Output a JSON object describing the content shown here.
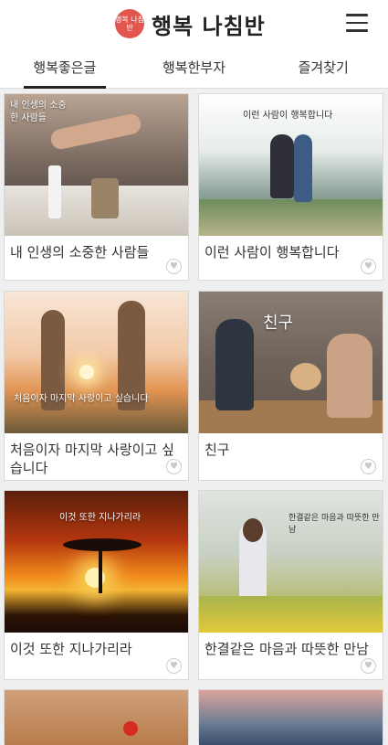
{
  "header": {
    "logo_badge": "행복 나침반",
    "title": "행복 나침반"
  },
  "tabs": [
    {
      "label": "행복좋은글"
    },
    {
      "label": "행복한부자"
    },
    {
      "label": "즐겨찾기"
    }
  ],
  "cards": [
    {
      "caption": "내 인생의 소중한 사람들",
      "overlay": "내 인생의 소중한 사람들"
    },
    {
      "caption": "이런 사람이 행복합니다",
      "overlay": "이런 사람이 행복합니다"
    },
    {
      "caption": "처음이자 마지막 사랑이고 싶습니다",
      "overlay": "처음이자 마지막 사랑이고 싶습니다"
    },
    {
      "caption": "친구",
      "overlay": "친구"
    },
    {
      "caption": "이것 또한 지나가리라",
      "overlay": "이것 또한 지나가리라"
    },
    {
      "caption": "한결같은 마음과 따뜻한 만남",
      "overlay": "한결같은 마음과 따뜻한 만남"
    }
  ],
  "colors": {
    "accent": "#e2564f"
  }
}
